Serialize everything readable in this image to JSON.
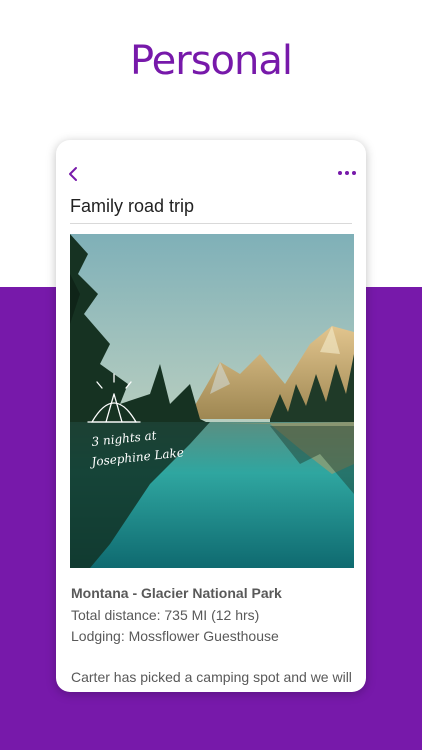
{
  "hero": {
    "title": "Personal"
  },
  "colors": {
    "accent": "#7719aa",
    "background": "#ffffff"
  },
  "card": {
    "nav": {
      "back_icon": "chevron-left-icon",
      "more_icon": "more-horizontal-icon"
    },
    "title": "Family road trip",
    "photo": {
      "icon": "tent-icon",
      "handwriting": [
        "3 nights at",
        "Josephine Lake"
      ]
    },
    "details": {
      "heading": "Montana - Glacier National Park",
      "distance": "Total distance: 735 MI (12 hrs)",
      "lodging": "Lodging: Mossflower Guesthouse"
    },
    "body": "Carter has picked a camping spot and we will"
  }
}
